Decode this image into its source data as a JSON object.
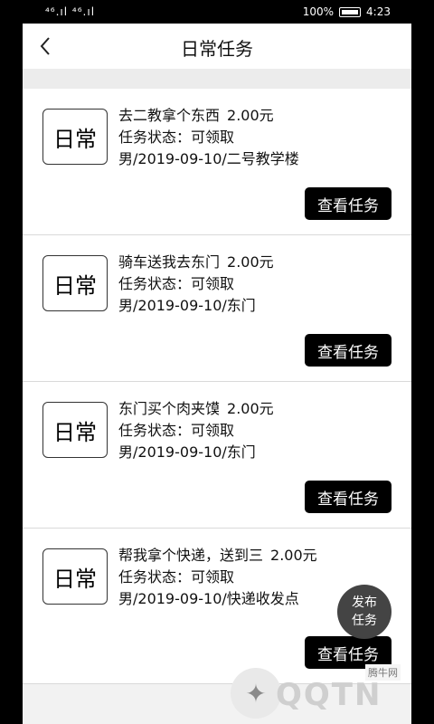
{
  "status_bar": {
    "signal": "⁴⁶.ıl ⁴⁶.ıl",
    "battery_percent": "100%",
    "time": "4:23"
  },
  "nav": {
    "title": "日常任务",
    "back_icon": "chevron-left-icon"
  },
  "tasks": [
    {
      "badge": "日常",
      "title": "去二教拿个东西",
      "price": "2.00元",
      "status": "任务状态：可领取",
      "meta": "男/2019-09-10/二号教学楼",
      "button": "查看任务"
    },
    {
      "badge": "日常",
      "title": "骑车送我去东门",
      "price": "2.00元",
      "status": "任务状态：可领取",
      "meta": "男/2019-09-10/东门",
      "button": "查看任务"
    },
    {
      "badge": "日常",
      "title": "东门买个肉夹馍",
      "price": "2.00元",
      "status": "任务状态：可领取",
      "meta": "男/2019-09-10/东门",
      "button": "查看任务"
    },
    {
      "badge": "日常",
      "title": "帮我拿个快递，送到三",
      "price": "2.00元",
      "status": "任务状态：可领取",
      "meta": "男/2019-09-10/快递收发点",
      "button": "查看任务"
    }
  ],
  "fab": {
    "line1": "发布",
    "line2": "任务"
  },
  "watermark": {
    "text": "QQTN",
    "site": "腾牛网"
  }
}
